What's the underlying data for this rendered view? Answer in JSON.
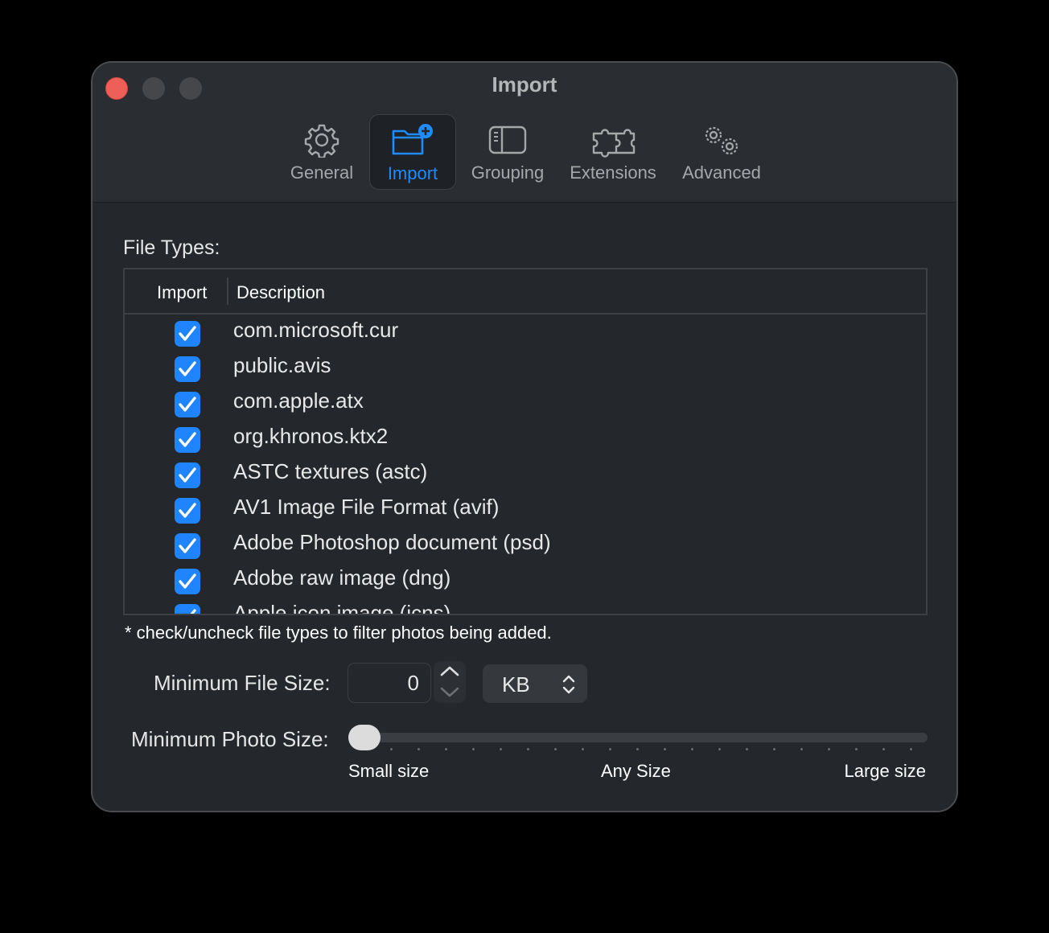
{
  "window": {
    "title": "Import"
  },
  "toolbar": {
    "tabs": [
      {
        "label": "General",
        "icon": "gear-icon"
      },
      {
        "label": "Import",
        "icon": "folder-plus-icon",
        "active": true
      },
      {
        "label": "Grouping",
        "icon": "sidebar-icon"
      },
      {
        "label": "Extensions",
        "icon": "puzzle-icon"
      },
      {
        "label": "Advanced",
        "icon": "gears-icon"
      }
    ]
  },
  "file_types": {
    "label": "File Types:",
    "columns": {
      "import": "Import",
      "description": "Description"
    },
    "rows": [
      {
        "checked": true,
        "description": "com.microsoft.cur"
      },
      {
        "checked": true,
        "description": "public.avis"
      },
      {
        "checked": true,
        "description": "com.apple.atx"
      },
      {
        "checked": true,
        "description": "org.khronos.ktx2"
      },
      {
        "checked": true,
        "description": "ASTC textures (astc)"
      },
      {
        "checked": true,
        "description": "AV1 Image File Format (avif)"
      },
      {
        "checked": true,
        "description": "Adobe Photoshop document (psd)"
      },
      {
        "checked": true,
        "description": "Adobe raw image (dng)"
      },
      {
        "checked": true,
        "description": "Apple icon image (icns)"
      }
    ],
    "hint": "* check/uncheck file types to filter photos being added."
  },
  "min_file_size": {
    "label": "Minimum File Size:",
    "value": "0",
    "unit": "KB"
  },
  "min_photo_size": {
    "label": "Minimum Photo Size:",
    "value_fraction": 0,
    "labels": {
      "min": "Small size",
      "mid": "Any Size",
      "max": "Large size"
    }
  },
  "colors": {
    "accent": "#1e84ff",
    "close": "#ed5f57",
    "background": "#24272b"
  }
}
